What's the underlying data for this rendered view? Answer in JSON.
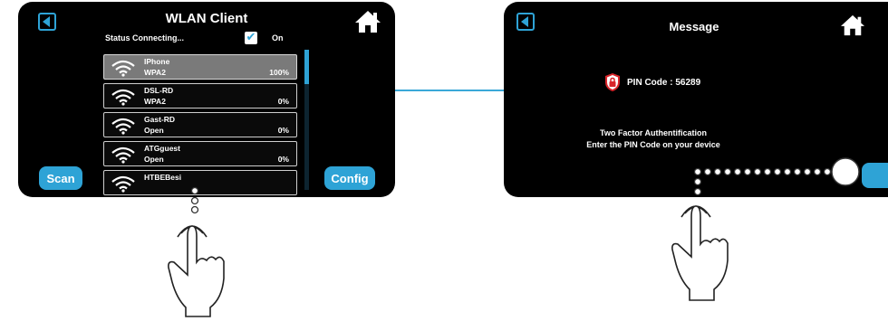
{
  "wlan_client": {
    "title": "WLAN Client",
    "status": "Status Connecting...",
    "on_label": "On",
    "networks": [
      {
        "ssid": "IPhone",
        "security": "WPA2",
        "signal": "100%"
      },
      {
        "ssid": "DSL-RD",
        "security": "WPA2",
        "signal": "0%"
      },
      {
        "ssid": "Gast-RD",
        "security": "Open",
        "signal": "0%"
      },
      {
        "ssid": "ATGguest",
        "security": "Open",
        "signal": "0%"
      },
      {
        "ssid": "HTBEBesi",
        "security": "",
        "signal": ""
      }
    ],
    "scan_label": "Scan",
    "config_label": "Config",
    "icons": {
      "back": "back-arrow-icon",
      "home": "home-icon",
      "wifi": "wifi-icon",
      "checkbox": "checkmark-icon"
    }
  },
  "message": {
    "title": "Message",
    "pin_label": "PIN Code : 56289",
    "line1": "Two Factor Authentification",
    "line2": "Enter the PIN Code on your device",
    "icons": {
      "back": "back-arrow-icon",
      "home": "home-icon",
      "lock": "lock-shield-icon"
    }
  },
  "colors": {
    "accent": "#2ea3d6",
    "screen": "#000000",
    "selected_row": "#7a7a7a",
    "lock": "#d9252a"
  }
}
